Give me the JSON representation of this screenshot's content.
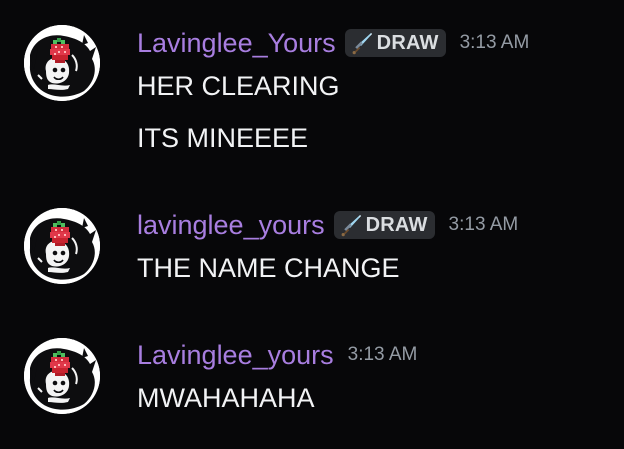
{
  "messages": [
    {
      "username": "Lavinglee_Yours",
      "tag": "DRAW",
      "time": "3:13 AM",
      "lines": [
        "HER CLEARING",
        "ITS MINEEEE"
      ]
    },
    {
      "username": "lavinglee_yours",
      "tag": "DRAW",
      "time": "3:13 AM",
      "lines": [
        "THE NAME CHANGE"
      ]
    },
    {
      "username": "Lavinglee_yours",
      "tag": "",
      "time": "3:13 AM",
      "lines": [
        "MWAHAHAHA"
      ]
    }
  ],
  "colors": {
    "background": "#070709",
    "username": "#a87ee0",
    "message_text": "#f2f3f5",
    "timestamp": "#949ba4",
    "tag_background": "#2b2d31"
  },
  "icons": {
    "avatar": "strawberry-ghost-avatar-icon",
    "tag": "sword-icon"
  }
}
